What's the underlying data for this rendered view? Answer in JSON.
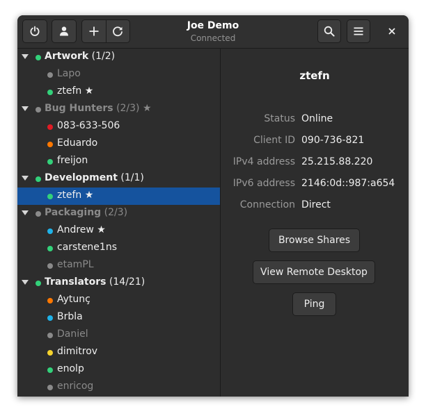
{
  "window": {
    "title": "Joe Demo",
    "subtitle": "Connected"
  },
  "toolbar": {
    "power_icon": "power-icon",
    "user_icon": "user-icon",
    "add_icon": "plus-icon",
    "refresh_icon": "refresh-icon",
    "search_icon": "search-icon",
    "menu_icon": "hamburger-menu-icon",
    "close_icon": "close-icon"
  },
  "colors": {
    "online": "#33d17a",
    "offline": "#8a8a8a",
    "busy": "#e01b24",
    "away": "#ff7800",
    "relay": "#1fb2e8",
    "idle": "#f6d32d",
    "selection": "#15539e"
  },
  "sidebar": {
    "groups": [
      {
        "name": "Artwork",
        "count": "(1/2)",
        "status": "online",
        "starred": false,
        "peers": [
          {
            "name": "Lapo",
            "status": "offline",
            "starred": false
          },
          {
            "name": "ztefn ★",
            "status": "online",
            "starred": true
          }
        ]
      },
      {
        "name": "Bug Hunters",
        "count": "(2/3) ★",
        "status": "offline",
        "starred": true,
        "peers": [
          {
            "name": "083-633-506",
            "status": "busy",
            "starred": false
          },
          {
            "name": "Eduardo",
            "status": "away",
            "starred": false
          },
          {
            "name": "freijon",
            "status": "online",
            "starred": false
          }
        ]
      },
      {
        "name": "Development",
        "count": "(1/1)",
        "status": "online",
        "starred": false,
        "peers": [
          {
            "name": "ztefn ★",
            "status": "online",
            "starred": true,
            "selected": true
          }
        ]
      },
      {
        "name": "Packaging",
        "count": "(2/3)",
        "status": "offline",
        "starred": false,
        "peers": [
          {
            "name": "Andrew ★",
            "status": "relay",
            "starred": true
          },
          {
            "name": "carstene1ns",
            "status": "online",
            "starred": false
          },
          {
            "name": "etamPL",
            "status": "offline",
            "starred": false
          }
        ]
      },
      {
        "name": "Translators",
        "count": "(14/21)",
        "status": "online",
        "starred": false,
        "peers": [
          {
            "name": "Aytunç",
            "status": "away",
            "starred": false
          },
          {
            "name": "Brbla",
            "status": "relay",
            "starred": false
          },
          {
            "name": "Daniel",
            "status": "offline",
            "starred": false
          },
          {
            "name": "dimitrov",
            "status": "idle",
            "starred": false
          },
          {
            "name": "enolp",
            "status": "online",
            "starred": false
          },
          {
            "name": "enricog",
            "status": "offline",
            "starred": false
          }
        ]
      }
    ]
  },
  "details": {
    "peer_name": "ztefn",
    "properties": [
      {
        "label": "Status",
        "value": "Online"
      },
      {
        "label": "Client ID",
        "value": "090-736-821"
      },
      {
        "label": "IPv4 address",
        "value": "25.215.88.220"
      },
      {
        "label": "IPv6 address",
        "value": "2146:0d::987:a654"
      },
      {
        "label": "Connection",
        "value": "Direct"
      }
    ],
    "buttons": {
      "browse_shares": "Browse Shares",
      "view_remote_desktop": "View Remote Desktop",
      "ping": "Ping"
    }
  }
}
